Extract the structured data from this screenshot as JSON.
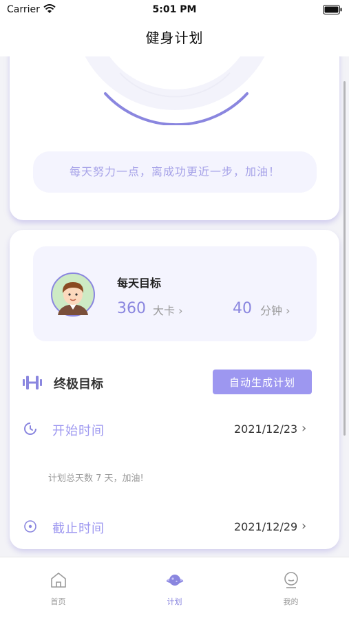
{
  "status_bar": {
    "carrier": "Carrier",
    "time": "5:01 PM"
  },
  "nav": {
    "title": "健身计划"
  },
  "progress_card": {
    "motto": "每天努力一点，离成功更近一步，加油！"
  },
  "daily_goal": {
    "title": "每天目标",
    "calories": "360",
    "calories_unit": "大卡 ›",
    "minutes": "40",
    "minutes_unit": "分钟 ›"
  },
  "ultimate_goal": {
    "label": "终极目标",
    "auto_button": "自动生成计划"
  },
  "start": {
    "label": "开始时间",
    "value": "2021/12/23"
  },
  "summary": "计划总天数 7 天，加油!",
  "end": {
    "label": "截止时间",
    "value": "2021/12/29"
  },
  "chevron": "›",
  "tabs": [
    {
      "label": "首页",
      "icon": "home-icon"
    },
    {
      "label": "计划",
      "icon": "planet-icon",
      "active": true
    },
    {
      "label": "我的",
      "icon": "profile-icon"
    }
  ],
  "colors": {
    "accent": "#9d97f0",
    "accent_dark": "#8a86df",
    "pill_bg": "#f4f4fe"
  }
}
